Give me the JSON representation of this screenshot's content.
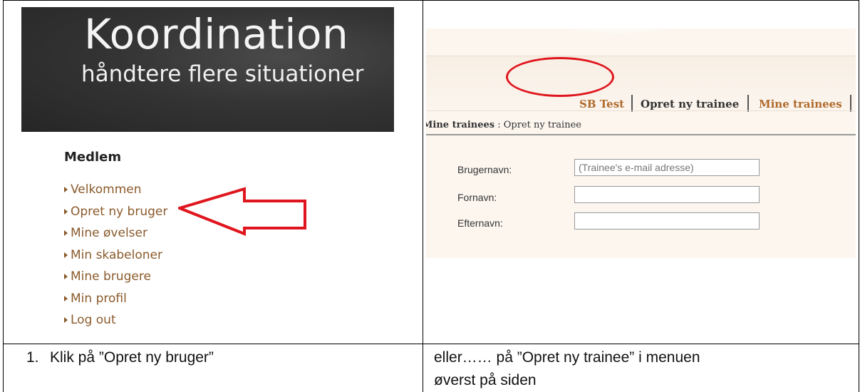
{
  "left_panel": {
    "banner": {
      "title": "Koordination",
      "subtitle": "håndtere flere situationer"
    },
    "menu_heading": "Medlem",
    "menu_items": [
      "Velkommen",
      "Opret ny bruger",
      "Mine øvelser",
      "Min skabeloner",
      "Mine brugere",
      "Min profil",
      "Log out"
    ],
    "arrow_color": "#e0161e"
  },
  "right_panel": {
    "nav": {
      "item1": "SB Test",
      "item2": "Opret ny trainee",
      "item3": "Mine trainees"
    },
    "breadcrumb": {
      "section": "Mine trainees",
      "separator": " : ",
      "page": "Opret ny trainee"
    },
    "form": {
      "username_label": "Brugernavn:",
      "username_placeholder": "(Trainee's e-mail adresse)",
      "firstname_label": "Fornavn:",
      "lastname_label": "Efternavn:"
    },
    "highlight_color": "#e0161e"
  },
  "captions": {
    "left_number": "1.",
    "left": "Klik på ”Opret ny bruger”",
    "right_line1": "eller…… på ”Opret ny trainee” i menuen",
    "right_line2": "øverst på siden"
  }
}
